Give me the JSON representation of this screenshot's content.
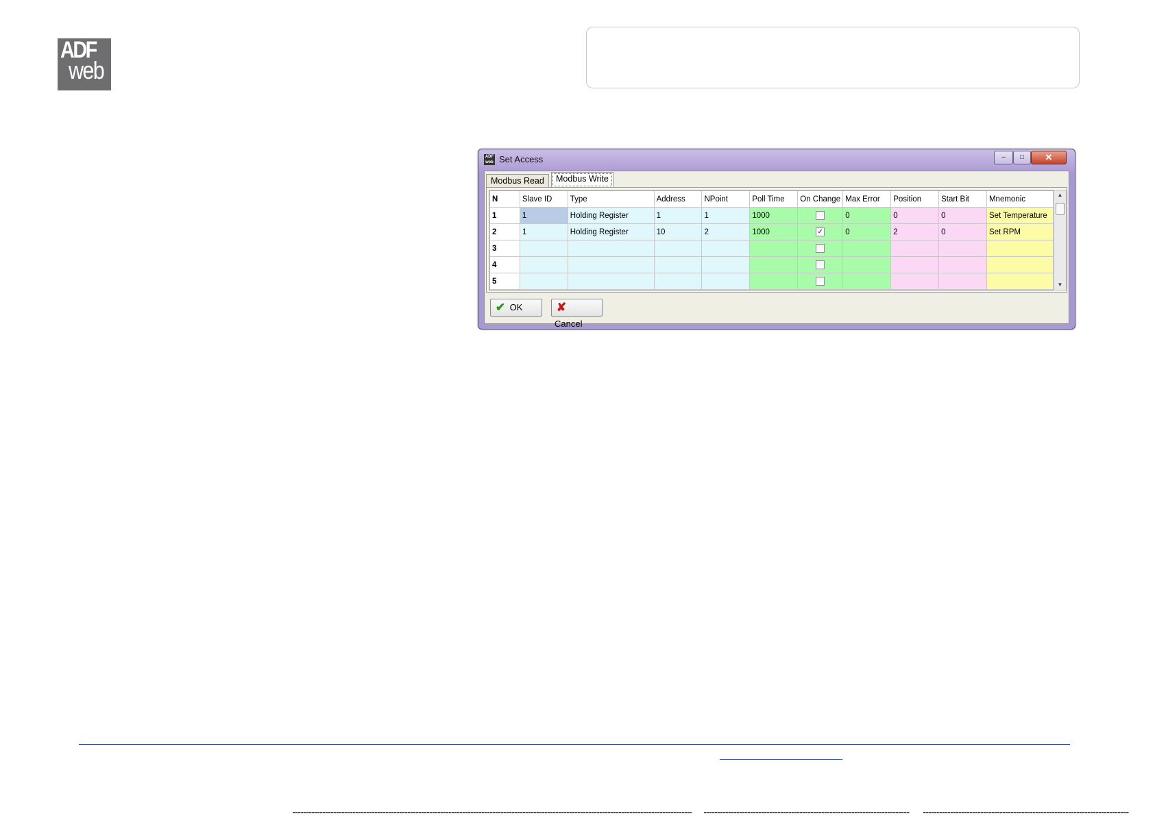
{
  "logo": {
    "line1": "ADF",
    "line2": "web"
  },
  "dialog": {
    "title": "Set Access",
    "window_buttons": {
      "minimize": "–",
      "maximize": "□",
      "close": "✕"
    },
    "tabs": [
      {
        "label": "Modbus Read",
        "active": false
      },
      {
        "label": "Modbus Write",
        "active": true
      }
    ],
    "columns": [
      "N",
      "Slave ID",
      "Type",
      "Address",
      "NPoint",
      "Poll Time",
      "On Change",
      "Max Error",
      "Position",
      "Start Bit",
      "Mnemonic"
    ],
    "rows": [
      {
        "n": "1",
        "slave_id": "1",
        "type": "Holding Register",
        "address": "1",
        "npoint": "1",
        "poll_time": "1000",
        "on_change": false,
        "max_error": "0",
        "position": "0",
        "start_bit": "0",
        "mnemonic": "Set Temperature"
      },
      {
        "n": "2",
        "slave_id": "1",
        "type": "Holding Register",
        "address": "10",
        "npoint": "2",
        "poll_time": "1000",
        "on_change": true,
        "max_error": "0",
        "position": "2",
        "start_bit": "0",
        "mnemonic": "Set RPM"
      },
      {
        "n": "3",
        "slave_id": "",
        "type": "",
        "address": "",
        "npoint": "",
        "poll_time": "",
        "on_change": false,
        "max_error": "",
        "position": "",
        "start_bit": "",
        "mnemonic": ""
      },
      {
        "n": "4",
        "slave_id": "",
        "type": "",
        "address": "",
        "npoint": "",
        "poll_time": "",
        "on_change": false,
        "max_error": "",
        "position": "",
        "start_bit": "",
        "mnemonic": ""
      },
      {
        "n": "5",
        "slave_id": "",
        "type": "",
        "address": "",
        "npoint": "",
        "poll_time": "",
        "on_change": false,
        "max_error": "",
        "position": "",
        "start_bit": "",
        "mnemonic": ""
      }
    ],
    "ok_label": "OK",
    "cancel_label": "Cancel",
    "check_glyph": "✓",
    "colors": {
      "id_cols": "#e0f7fb",
      "poll_cols": "#a8fba8",
      "position_cols": "#fbd8f3",
      "mnemonic_col": "#fdfca6",
      "selected_cell": "#b8cce8",
      "title_bar": "#b6a6da"
    }
  }
}
